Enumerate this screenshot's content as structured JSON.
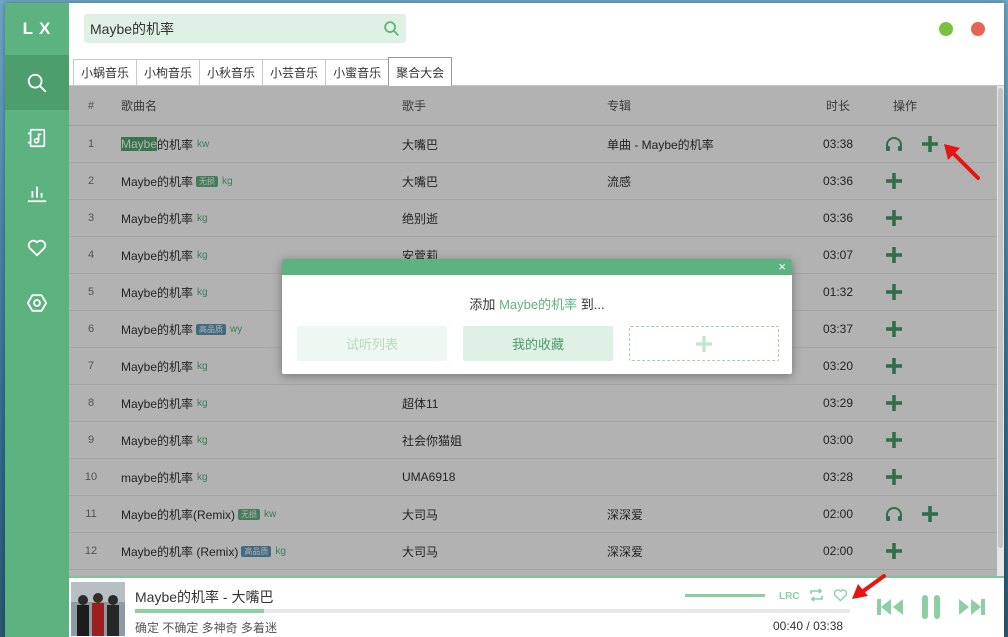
{
  "app": {
    "logo": "LX",
    "accent": "#5cb37f",
    "dark_accent": "#4c9f6d"
  },
  "sidebar": {
    "items": [
      {
        "name": "search",
        "icon": "search-icon"
      },
      {
        "name": "song-list",
        "icon": "music-list-icon"
      },
      {
        "name": "leaderboard",
        "icon": "chart-bars-icon"
      },
      {
        "name": "favorites",
        "icon": "heart-icon"
      },
      {
        "name": "settings",
        "icon": "settings-hexagon-icon"
      }
    ]
  },
  "search": {
    "value": "Maybe的机率",
    "icon": "search-icon"
  },
  "window": {
    "min_color": "#7cc03f",
    "close_color": "#e56454"
  },
  "tabs": [
    {
      "label": "小蜗音乐",
      "active": false
    },
    {
      "label": "小枸音乐",
      "active": false
    },
    {
      "label": "小秋音乐",
      "active": false
    },
    {
      "label": "小芸音乐",
      "active": false
    },
    {
      "label": "小蜜音乐",
      "active": false
    },
    {
      "label": "聚合大会",
      "active": true
    }
  ],
  "table": {
    "headers": {
      "num": "#",
      "name": "歌曲名",
      "singer": "歌手",
      "album": "专辑",
      "duration": "时长",
      "ops": "操作"
    },
    "rows": [
      {
        "num": "1",
        "name_hl": "Maybe",
        "name_rest": "的机率",
        "badge": "",
        "source": "kw",
        "singer": "大嘴巴",
        "album": "单曲 - Maybe的机率",
        "duration": "03:38",
        "listen": true
      },
      {
        "num": "2",
        "name_hl": "",
        "name_rest": "Maybe的机率",
        "badge": "无损",
        "source": "kg",
        "singer": "大嘴巴",
        "album": "流感",
        "duration": "03:36",
        "listen": false
      },
      {
        "num": "3",
        "name_hl": "",
        "name_rest": "Maybe的机率",
        "badge": "",
        "source": "kg",
        "singer": "绝别逝",
        "album": "",
        "duration": "03:36",
        "listen": false
      },
      {
        "num": "4",
        "name_hl": "",
        "name_rest": "Maybe的机率",
        "badge": "",
        "source": "kg",
        "singer": "安菅莉",
        "album": "",
        "duration": "03:07",
        "listen": false
      },
      {
        "num": "5",
        "name_hl": "",
        "name_rest": "Maybe的机率",
        "badge": "",
        "source": "kg",
        "singer": "",
        "album": "",
        "duration": "01:32",
        "listen": false
      },
      {
        "num": "6",
        "name_hl": "",
        "name_rest": "Maybe的机率",
        "badge": "高品质",
        "source": "wy",
        "singer": "",
        "album": "",
        "duration": "03:37",
        "listen": false
      },
      {
        "num": "7",
        "name_hl": "",
        "name_rest": "Maybe的机率",
        "badge": "",
        "source": "kg",
        "singer": "",
        "album": "",
        "duration": "03:20",
        "listen": false
      },
      {
        "num": "8",
        "name_hl": "",
        "name_rest": "Maybe的机率",
        "badge": "",
        "source": "kg",
        "singer": "超体11",
        "album": "",
        "duration": "03:29",
        "listen": false
      },
      {
        "num": "9",
        "name_hl": "",
        "name_rest": "Maybe的机率",
        "badge": "",
        "source": "kg",
        "singer": "社会你猫姐",
        "album": "",
        "duration": "03:00",
        "listen": false
      },
      {
        "num": "10",
        "name_hl": "",
        "name_rest": "maybe的机率",
        "badge": "",
        "source": "kg",
        "singer": "UMA6918",
        "album": "",
        "duration": "03:28",
        "listen": false
      },
      {
        "num": "11",
        "name_hl": "",
        "name_rest": "Maybe的机率(Remix)",
        "badge": "无损",
        "source": "kw",
        "singer": "大司马",
        "album": "深深爱",
        "duration": "02:00",
        "listen": true
      },
      {
        "num": "12",
        "name_hl": "",
        "name_rest": "Maybe的机率 (Remix)",
        "badge": "高品质",
        "source": "kg",
        "singer": "大司马",
        "album": "深深爱",
        "duration": "02:00",
        "listen": false
      }
    ]
  },
  "modal": {
    "prefix": "添加",
    "song": "Maybe的机率",
    "suffix": "到...",
    "close": "×",
    "btn_listen": "试听列表",
    "btn_favorite": "我的收藏",
    "btn_new_icon": "plus-icon"
  },
  "player": {
    "title": "Maybe的机率 - 大嘴巴",
    "lyric": "确定 不确定 多神奇 多着迷",
    "time_current": "00:40",
    "time_sep": "/",
    "time_total": "03:38",
    "progress": 0.18,
    "volume": 1.0,
    "icons": [
      "lyric-icon",
      "repeat-icon",
      "heart-icon",
      "previous-icon",
      "pause-icon",
      "next-icon"
    ]
  }
}
